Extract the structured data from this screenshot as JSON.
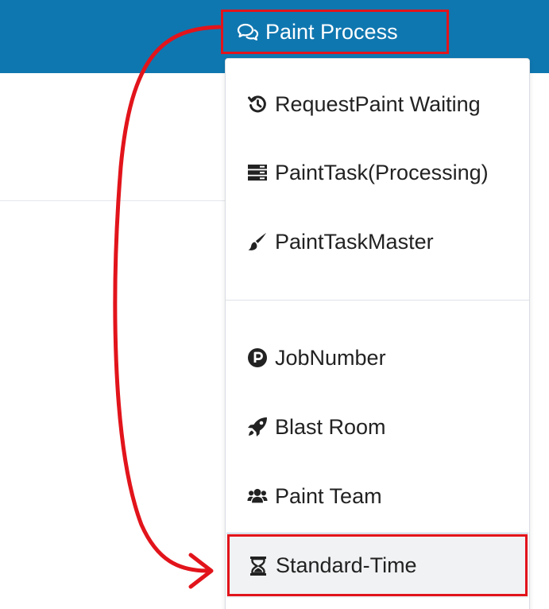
{
  "navbar": {
    "item_label": "Paint Process",
    "item_icon": "comments-icon",
    "background_color": "#0f77b0"
  },
  "dropdown": {
    "items": [
      {
        "label": "RequestPaint Waiting",
        "icon": "history-icon"
      },
      {
        "label": "PaintTask(Processing)",
        "icon": "server-icon"
      },
      {
        "label": "PaintTaskMaster",
        "icon": "paint-brush-icon"
      },
      {
        "label": "JobNumber",
        "icon": "parking-icon"
      },
      {
        "label": "Blast Room",
        "icon": "rocket-icon"
      },
      {
        "label": "Paint Team",
        "icon": "users-icon"
      },
      {
        "label": "Standard-Time",
        "icon": "hourglass-icon"
      }
    ],
    "active_item": "Standard-Time"
  },
  "annotation": {
    "highlight_color": "#e2141b",
    "arrow": "curved arrow from Paint Process to Standard-Time"
  }
}
